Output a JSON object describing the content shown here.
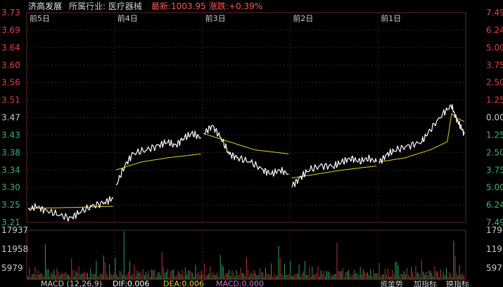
{
  "header": {
    "stock_name": "济高发展",
    "industry": "所属行业: 医疗器械",
    "latest": "最新:1003.95",
    "change": "涨跌:+0.39%"
  },
  "colors": {
    "background": "#000000",
    "up": "#e04040",
    "down": "#3cb371",
    "neutral": "#cccccc",
    "price_line": "#ffffff",
    "avg_line": "#e6d21e",
    "grid": "#3a1f1f",
    "volume_up": "#c03030",
    "volume_down": "#2e9e5e"
  },
  "chart_data": {
    "type": "line",
    "title": "",
    "day_labels": [
      "前5日",
      "前4日",
      "前3日",
      "前2日",
      "前1日"
    ],
    "price_ticks": [
      "3.73",
      "3.69",
      "3.64",
      "3.60",
      "3.56",
      "3.51",
      "3.47",
      "3.43",
      "3.38",
      "3.34",
      "3.30",
      "3.25",
      "3.21"
    ],
    "percent_ticks": [
      "7.49",
      "6.24",
      "5.00",
      "3.75",
      "2.50",
      "1.25",
      "0.00",
      "1.25",
      "2.50",
      "3.75",
      "5.00",
      "6.24",
      "7.49"
    ],
    "ylim": [
      3.21,
      3.73
    ],
    "base_price": 3.47,
    "volume_ticks": [
      "17937",
      "11958",
      "5979"
    ],
    "volume_max": 17937,
    "series": [
      {
        "kind": "price",
        "days": [
          {
            "points": [
              [
                0,
                3.24
              ],
              [
                0.1,
                3.25
              ],
              [
                0.2,
                3.24
              ],
              [
                0.35,
                3.23
              ],
              [
                0.5,
                3.22
              ],
              [
                0.6,
                3.235
              ],
              [
                0.75,
                3.25
              ],
              [
                0.9,
                3.26
              ],
              [
                1.0,
                3.27
              ]
            ]
          },
          {
            "points": [
              [
                0,
                3.3
              ],
              [
                0.1,
                3.35
              ],
              [
                0.2,
                3.38
              ],
              [
                0.35,
                3.39
              ],
              [
                0.5,
                3.4
              ],
              [
                0.6,
                3.41
              ],
              [
                0.7,
                3.4
              ],
              [
                0.8,
                3.42
              ],
              [
                0.9,
                3.43
              ],
              [
                1.0,
                3.42
              ]
            ]
          },
          {
            "points": [
              [
                0,
                3.43
              ],
              [
                0.1,
                3.45
              ],
              [
                0.2,
                3.42
              ],
              [
                0.3,
                3.38
              ],
              [
                0.4,
                3.37
              ],
              [
                0.55,
                3.36
              ],
              [
                0.7,
                3.34
              ],
              [
                0.8,
                3.33
              ],
              [
                0.9,
                3.34
              ],
              [
                1.0,
                3.33
              ]
            ]
          },
          {
            "points": [
              [
                0,
                3.3
              ],
              [
                0.1,
                3.32
              ],
              [
                0.2,
                3.34
              ],
              [
                0.35,
                3.35
              ],
              [
                0.5,
                3.35
              ],
              [
                0.6,
                3.36
              ],
              [
                0.7,
                3.37
              ],
              [
                0.8,
                3.36
              ],
              [
                0.9,
                3.37
              ],
              [
                1.0,
                3.36
              ]
            ]
          },
          {
            "points": [
              [
                0,
                3.36
              ],
              [
                0.1,
                3.38
              ],
              [
                0.2,
                3.39
              ],
              [
                0.35,
                3.4
              ],
              [
                0.5,
                3.41
              ],
              [
                0.6,
                3.44
              ],
              [
                0.75,
                3.48
              ],
              [
                0.85,
                3.5
              ],
              [
                0.9,
                3.47
              ],
              [
                0.95,
                3.45
              ],
              [
                1.0,
                3.43
              ]
            ]
          }
        ]
      },
      {
        "kind": "average",
        "days": [
          {
            "points": [
              [
                0,
                3.245
              ],
              [
                0.5,
                3.247
              ],
              [
                1.0,
                3.25
              ]
            ]
          },
          {
            "points": [
              [
                0,
                3.34
              ],
              [
                0.3,
                3.36
              ],
              [
                0.6,
                3.37
              ],
              [
                1.0,
                3.38
              ]
            ]
          },
          {
            "points": [
              [
                0,
                3.43
              ],
              [
                0.3,
                3.41
              ],
              [
                0.6,
                3.39
              ],
              [
                1.0,
                3.38
              ]
            ]
          },
          {
            "points": [
              [
                0,
                3.32
              ],
              [
                0.3,
                3.33
              ],
              [
                0.6,
                3.34
              ],
              [
                1.0,
                3.35
              ]
            ]
          },
          {
            "points": [
              [
                0,
                3.36
              ],
              [
                0.3,
                3.37
              ],
              [
                0.6,
                3.39
              ],
              [
                0.8,
                3.41
              ],
              [
                0.85,
                3.48
              ],
              [
                0.9,
                3.47
              ],
              [
                1.0,
                3.46
              ]
            ]
          }
        ]
      }
    ],
    "volume_sample": [
      3000,
      6000,
      2000,
      4500,
      2500,
      5000,
      3500,
      7000,
      2000,
      3000,
      4000,
      2500,
      17000,
      9000,
      5000,
      3000,
      6000,
      2500,
      4000,
      3500,
      8000,
      3000,
      2000,
      5000,
      4000,
      3000,
      6500,
      2500,
      4500,
      3000,
      9000,
      4000,
      3000,
      5500,
      2500,
      7000,
      3500,
      4000,
      3000,
      6000
    ]
  },
  "footer": {
    "macd_label": "MACD (12,26,9)",
    "dif": "DIF:0.006",
    "dea": "DEA:0.006",
    "macd": "MACD:0.000",
    "tabs": [
      "资金势",
      "加指标",
      "换指标"
    ]
  }
}
